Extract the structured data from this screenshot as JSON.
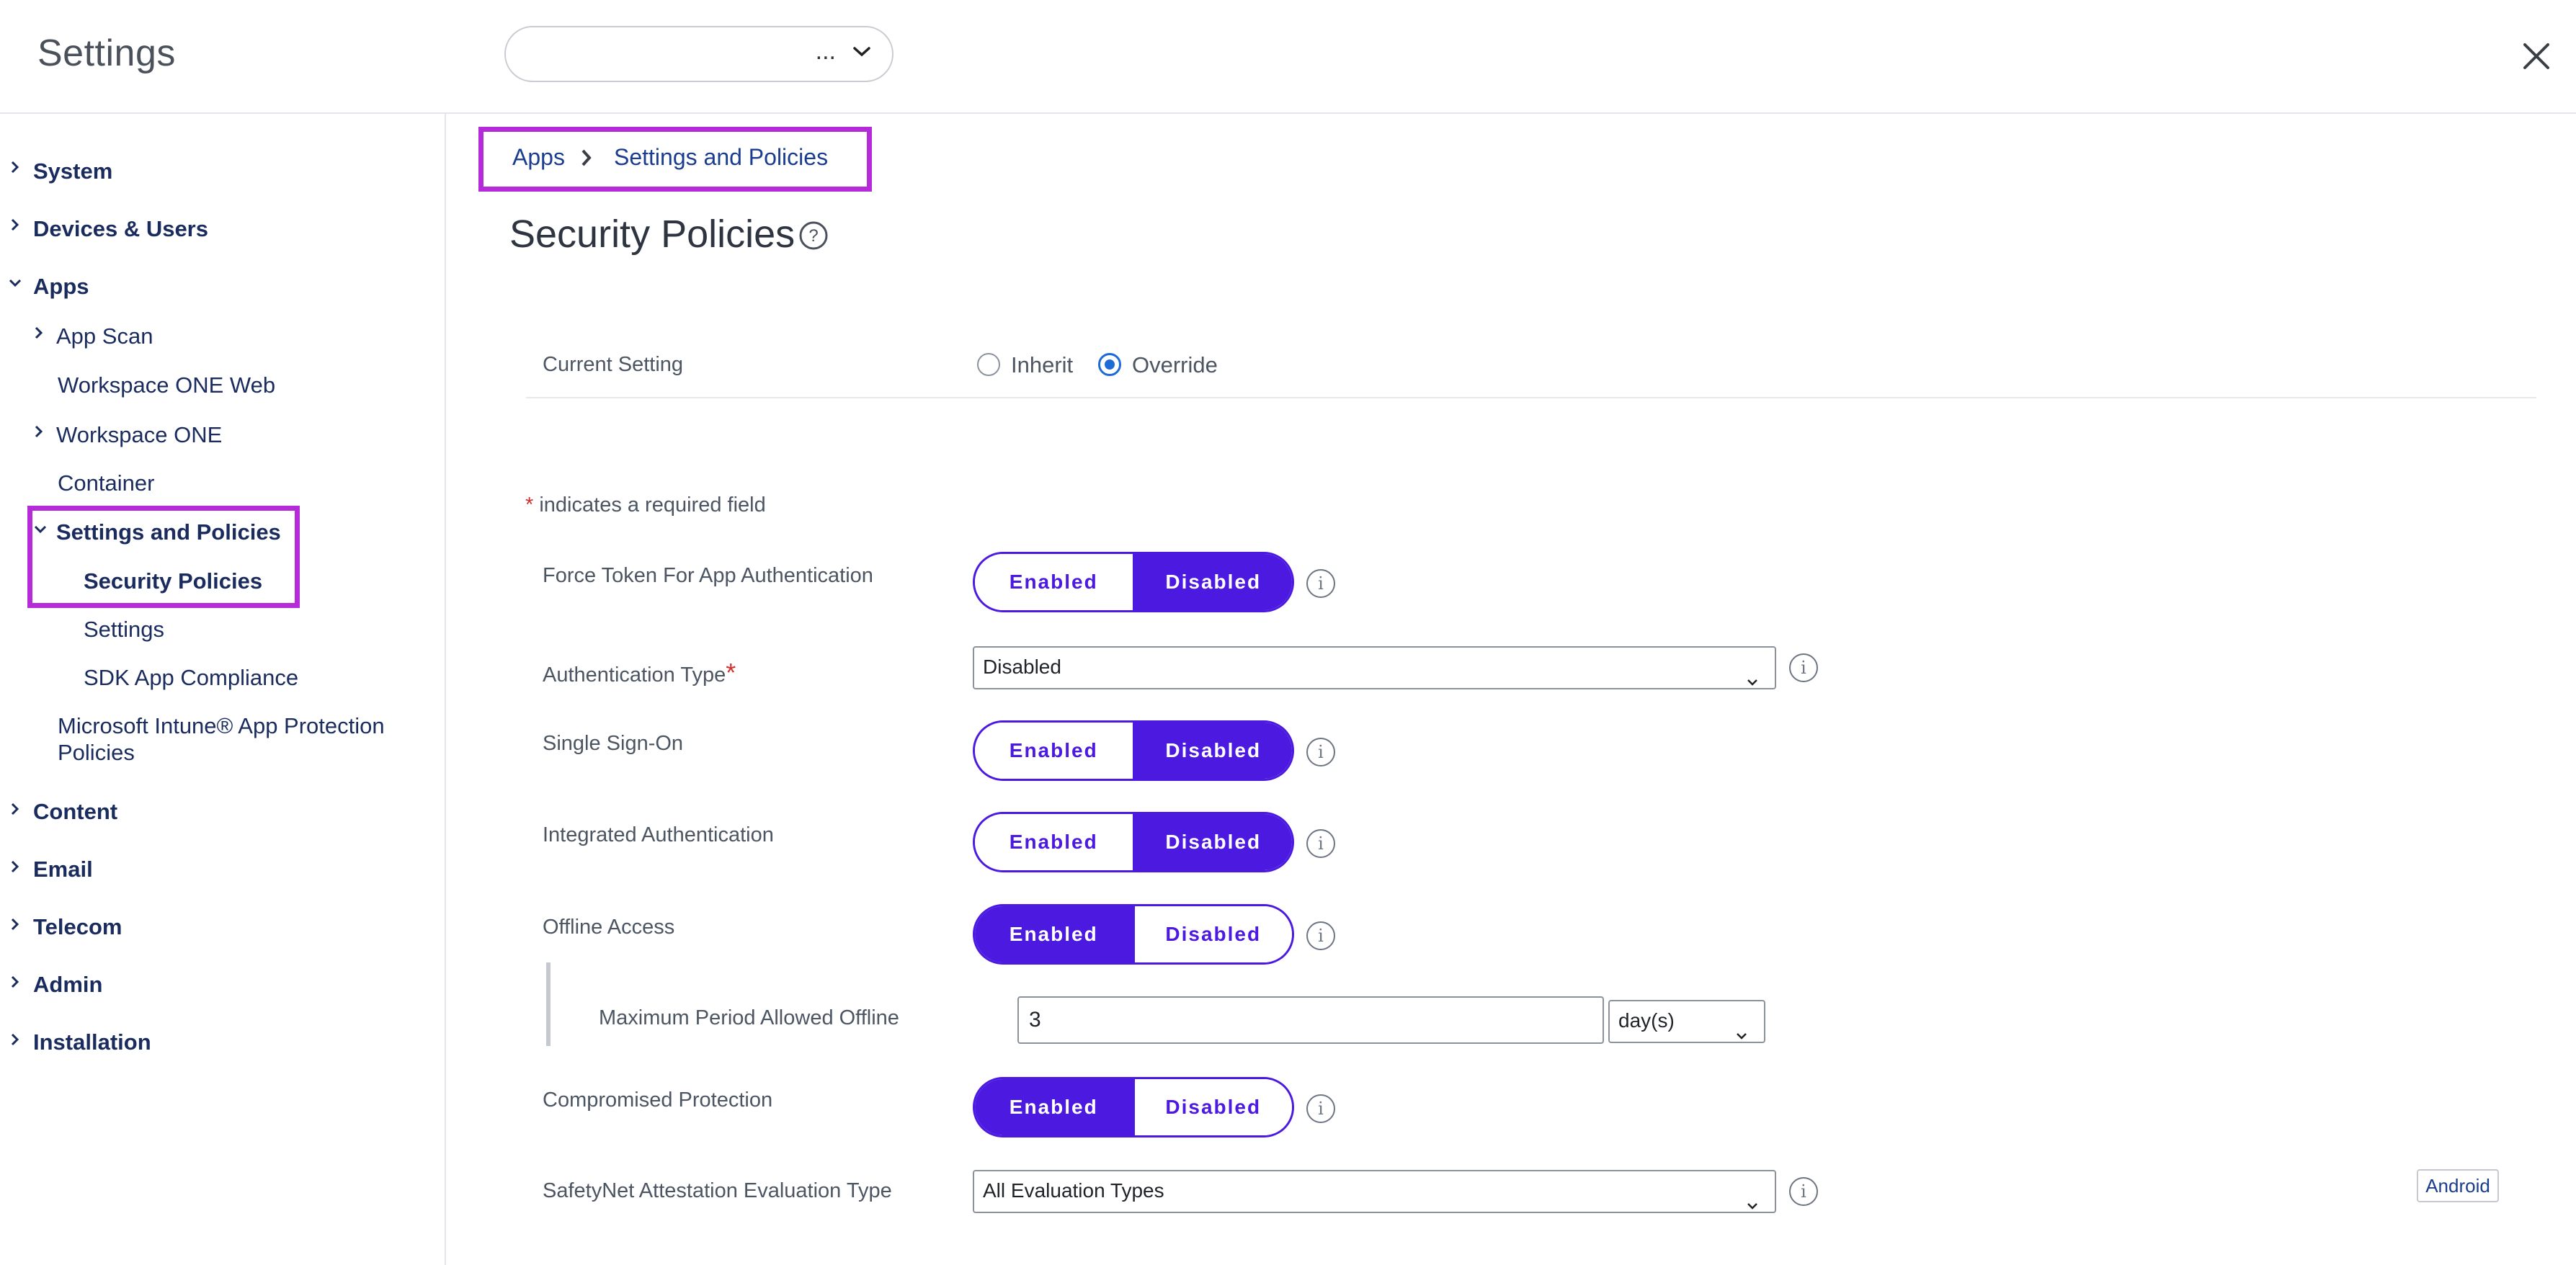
{
  "header": {
    "title": "Settings",
    "org_select_value": "..."
  },
  "breadcrumb": {
    "items": [
      "Apps",
      "Settings and Policies"
    ]
  },
  "sidebar": {
    "items": [
      {
        "label": "System"
      },
      {
        "label": "Devices & Users"
      },
      {
        "label": "Apps"
      },
      {
        "label": "App Scan"
      },
      {
        "label": "Workspace ONE Web"
      },
      {
        "label": "Workspace ONE"
      },
      {
        "label": "Container"
      },
      {
        "label": "Settings and Policies"
      },
      {
        "label": "Security Policies"
      },
      {
        "label": "Settings"
      },
      {
        "label": "SDK App Compliance"
      },
      {
        "label": "Microsoft Intune® App Protection"
      },
      {
        "label": "Policies"
      },
      {
        "label": "Content"
      },
      {
        "label": "Email"
      },
      {
        "label": "Telecom"
      },
      {
        "label": "Admin"
      },
      {
        "label": "Installation"
      }
    ]
  },
  "main": {
    "title": "Security Policies",
    "current_setting": {
      "label": "Current Setting",
      "options": [
        "Inherit",
        "Override"
      ],
      "selected": "Override"
    },
    "required_note": "indicates a required field",
    "required_star": "*",
    "toggle_labels": {
      "enabled": "Enabled",
      "disabled": "Disabled"
    },
    "rows": [
      {
        "label": "Force Token For App Authentication",
        "value": "Disabled"
      },
      {
        "label": "Authentication Type",
        "value": "Disabled"
      },
      {
        "label": "Single Sign-On",
        "value": "Disabled"
      },
      {
        "label": "Integrated Authentication",
        "value": "Disabled"
      },
      {
        "label": "Offline Access",
        "value": "Enabled"
      },
      {
        "label": "Maximum Period Allowed Offline",
        "value": "3",
        "unit": "day(s)"
      },
      {
        "label": "Compromised Protection",
        "value": "Enabled"
      },
      {
        "label": "SafetyNet Attestation Evaluation Type",
        "value": "All Evaluation Types",
        "badge": "Android"
      }
    ]
  },
  "colors": {
    "accent": "#4b19e0",
    "nav_text": "#1a2b5e",
    "highlight": "#b52bd9",
    "radio": "#1d6ad8"
  }
}
